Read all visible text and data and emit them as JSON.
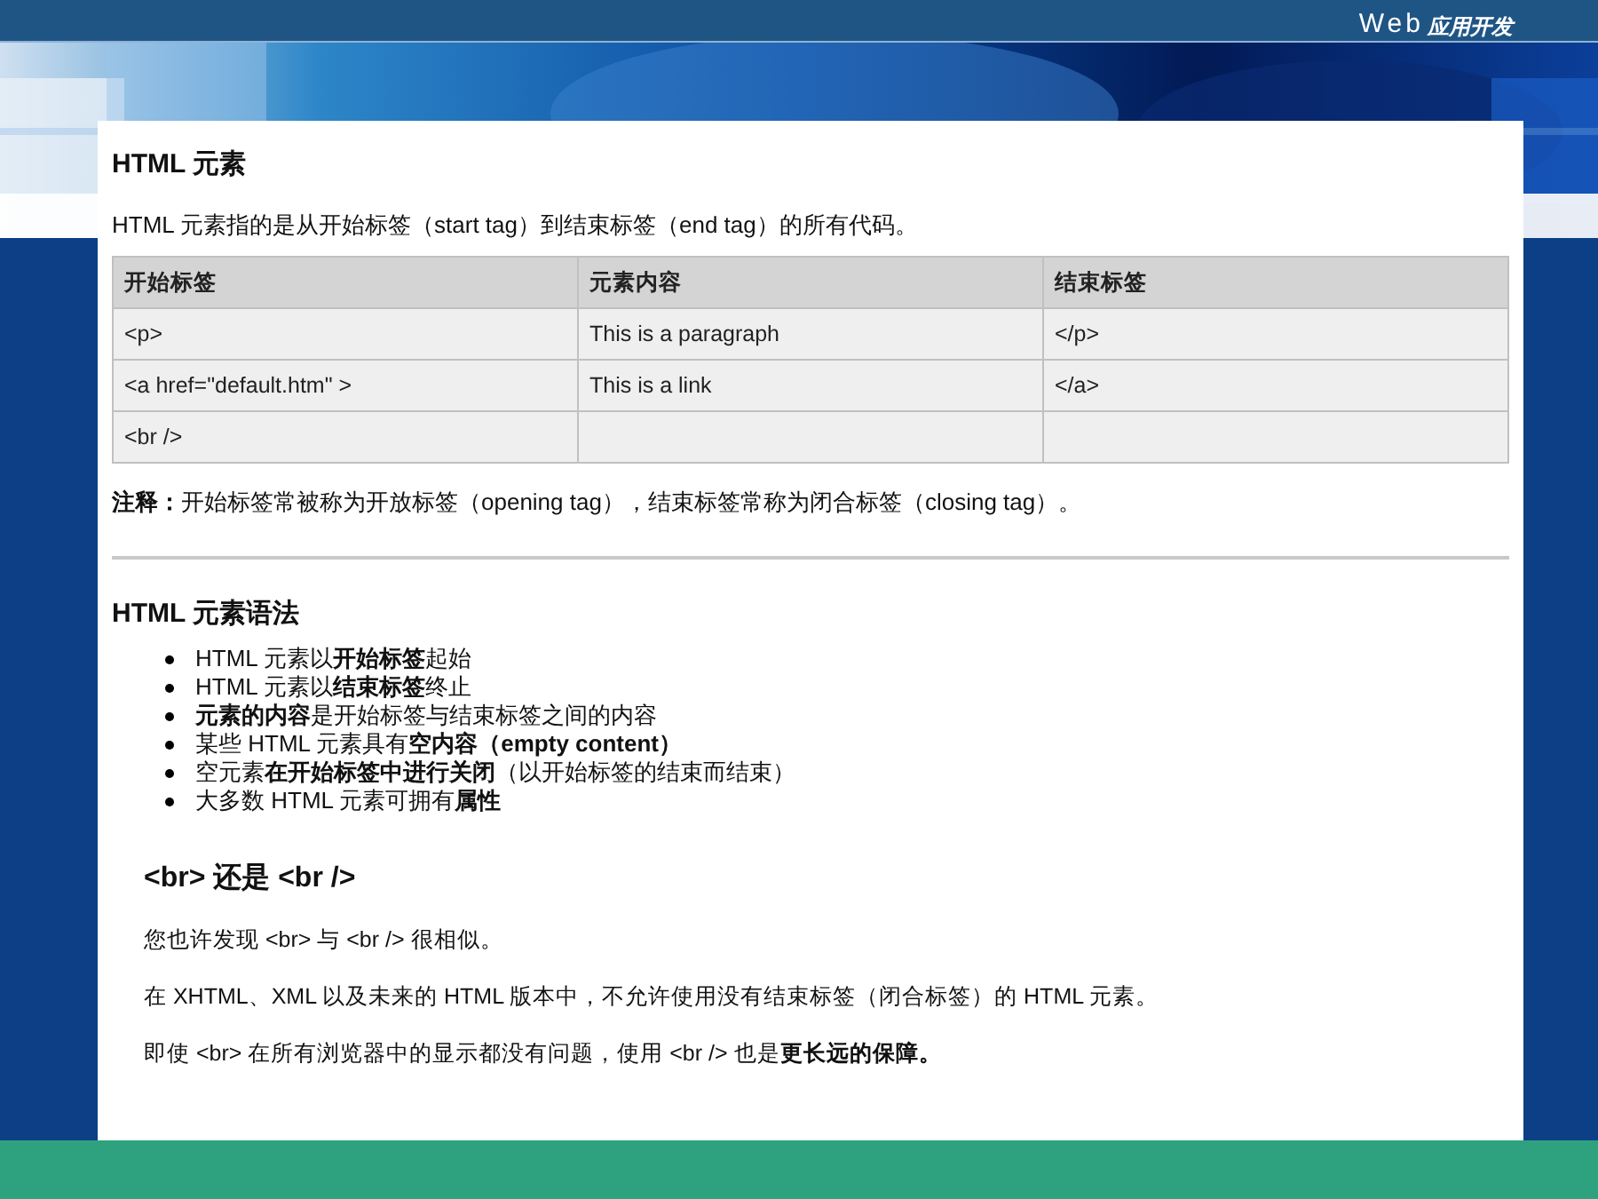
{
  "header": {
    "title": "Web",
    "subtitle": "应用开发"
  },
  "section_1": {
    "heading": "HTML 元素",
    "intro": "HTML 元素指的是从开始标签（start tag）到结束标签（end tag）的所有代码。"
  },
  "table": {
    "columns": [
      "开始标签",
      "元素内容",
      "结束标签"
    ],
    "rows": [
      [
        "<p>",
        "This is a paragraph",
        "</p>"
      ],
      [
        "<a href=\"default.htm\" >",
        "This is a link",
        "</a>"
      ],
      [
        "<br />"
      ]
    ]
  },
  "note": "**注释：**开始标签常被称为开放标签（opening tag），结束标签常称为闭合标签（closing tag）。",
  "section_2": {
    "heading": "HTML 元素语法",
    "bullets": [
      "HTML 元素以**开始标签**起始",
      "HTML 元素以**结束标签**终止",
      "**元素的内容**是开始标签与结束标签之间的内容",
      "某些 HTML 元素具有**空内容（empty content）**",
      "空元素**在开始标签中进行关闭**（以开始标签的结束而结束）",
      "大多数 HTML 元素可拥有**属性**"
    ]
  },
  "section_3": {
    "heading": "<br> 还是 <br />",
    "paragraphs": [
      "您也许发现 <br> 与 <br /> 很相似。",
      "在 XHTML、XML 以及未来的 HTML 版本中，不允许使用没有结束标签（闭合标签）的 HTML 元素。",
      "即使 <br> 在所有浏览器中的显示都没有问题，使用 <br /> 也是**更长远的保障。**"
    ]
  }
}
